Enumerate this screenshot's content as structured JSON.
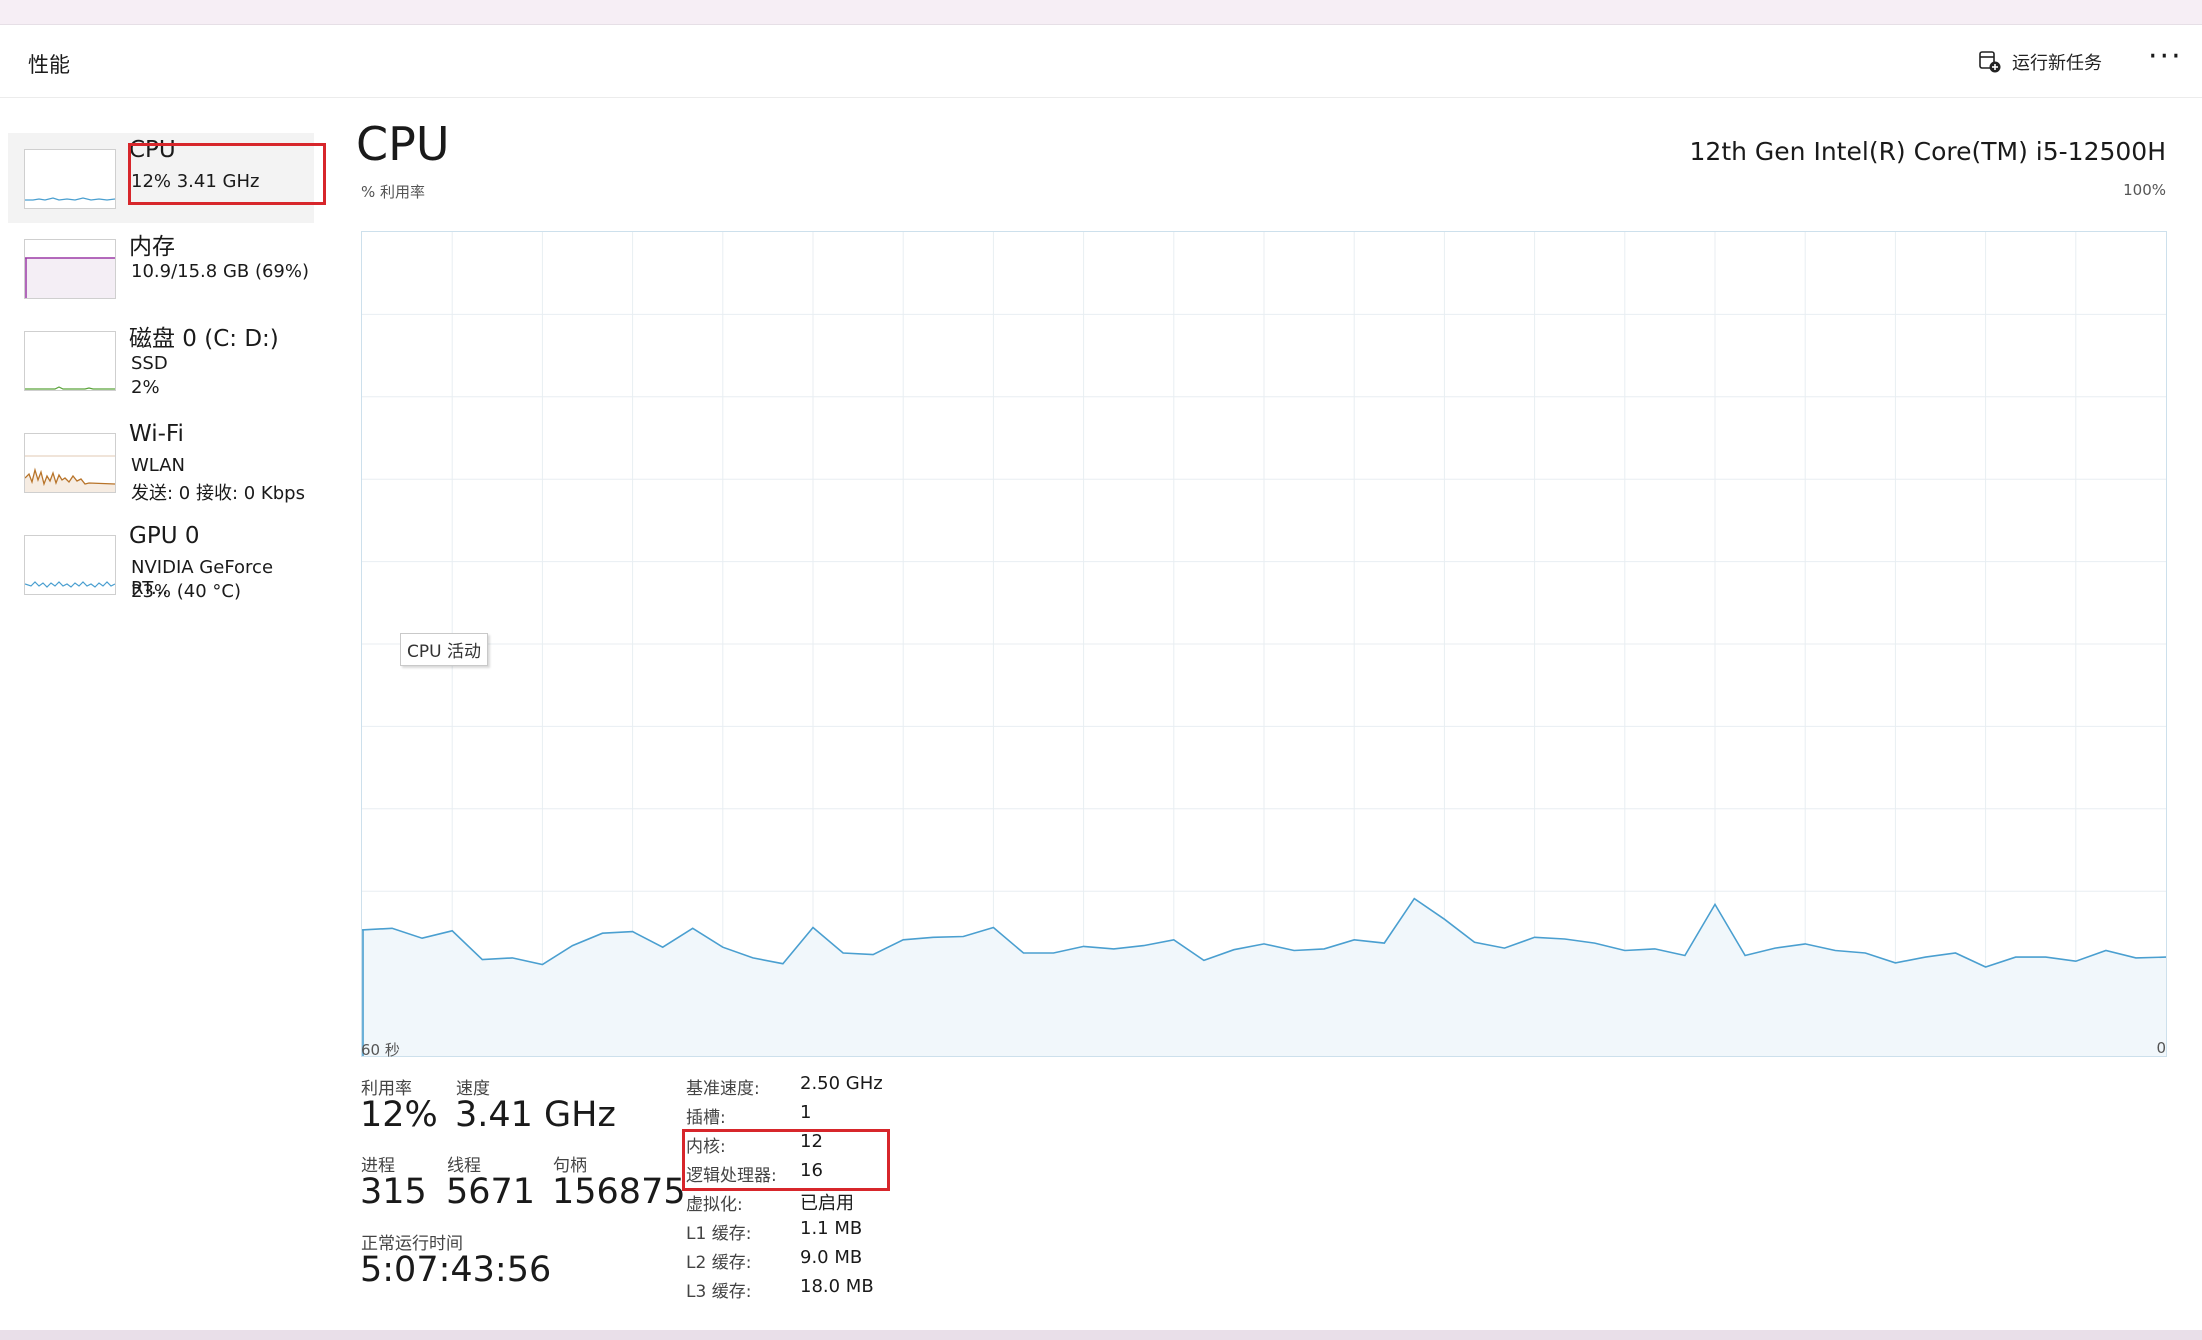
{
  "header": {
    "title": "性能",
    "run_task_label": "运行新任务",
    "more_label": "···"
  },
  "sidebar": {
    "items": [
      {
        "title": "CPU",
        "line1": "12%  3.41 GHz",
        "line2": ""
      },
      {
        "title": "内存",
        "line1": "10.9/15.8 GB (69%)",
        "line2": ""
      },
      {
        "title": "磁盘 0 (C: D:)",
        "line1": "SSD",
        "line2": "2%"
      },
      {
        "title": "Wi-Fi",
        "line1": "WLAN",
        "line2": "发送: 0 接收: 0 Kbps"
      },
      {
        "title": "GPU 0",
        "line1": "NVIDIA GeForce RT...",
        "line2": "23%  (40 °C)"
      }
    ]
  },
  "main": {
    "title": "CPU",
    "cpu_model": "12th Gen Intel(R) Core(TM) i5-12500H",
    "y_axis_label": "% 利用率",
    "y_max_label": "100%",
    "x_left_label": "60 秒",
    "x_right_label": "0",
    "tooltip": "CPU 活动"
  },
  "chart_data": {
    "type": "area",
    "ylim": [
      0,
      100
    ],
    "xlim": [
      60,
      0
    ],
    "ylabel": "% 利用率",
    "grid": true,
    "color": "#4a9fd0",
    "x": [
      60,
      59,
      58,
      57,
      56,
      55,
      54,
      53,
      52,
      51,
      50,
      49,
      48,
      47,
      46,
      45,
      44,
      43,
      42,
      41,
      40,
      39,
      38,
      37,
      36,
      35,
      34,
      33,
      32,
      31,
      30,
      29,
      28,
      27,
      26,
      25,
      24,
      23,
      22,
      21,
      20,
      19,
      18,
      17,
      16,
      15,
      14,
      13,
      12,
      11,
      10,
      9,
      8,
      7,
      6,
      5,
      4,
      3,
      2,
      1,
      0
    ],
    "values": [
      15.3,
      15.5,
      14.3,
      15.2,
      11.7,
      11.9,
      11.1,
      13.4,
      14.9,
      15.1,
      13.2,
      15.5,
      13.2,
      11.9,
      11.2,
      15.6,
      12.5,
      12.3,
      14.1,
      14.4,
      14.5,
      15.6,
      12.5,
      12.5,
      13.3,
      13.0,
      13.4,
      14.1,
      11.6,
      12.9,
      13.6,
      12.8,
      13.0,
      14.1,
      13.7,
      19.1,
      16.6,
      13.8,
      13.1,
      14.4,
      14.2,
      13.7,
      12.8,
      13.0,
      12.2,
      18.4,
      12.2,
      13.1,
      13.6,
      12.8,
      12.5,
      11.3,
      12.0,
      12.5,
      10.8,
      12.0,
      12.0,
      11.5,
      12.8,
      11.9,
      12.0
    ]
  },
  "stats": {
    "utilization_label": "利用率",
    "utilization_value": "12%",
    "speed_label": "速度",
    "speed_value": "3.41 GHz",
    "processes_label": "进程",
    "processes_value": "315",
    "threads_label": "线程",
    "threads_value": "5671",
    "handles_label": "句柄",
    "handles_value": "156875",
    "uptime_label": "正常运行时间",
    "uptime_value": "5:07:43:56"
  },
  "specs": [
    {
      "label": "基准速度:",
      "value": "2.50 GHz"
    },
    {
      "label": "插槽:",
      "value": "1"
    },
    {
      "label": "内核:",
      "value": "12"
    },
    {
      "label": "逻辑处理器:",
      "value": "16"
    },
    {
      "label": "虚拟化:",
      "value": "已启用"
    },
    {
      "label": "L1 缓存:",
      "value": "1.1 MB"
    },
    {
      "label": "L2 缓存:",
      "value": "9.0 MB"
    },
    {
      "label": "L3 缓存:",
      "value": "18.0 MB"
    }
  ],
  "colors": {
    "cpu": "#4a9fd0",
    "memory": "#9b3aa6",
    "disk": "#5aa33a",
    "wifi": "#b8742a",
    "gpu": "#4a9fd0",
    "highlight": "#d7262b"
  },
  "icons": {
    "run_task": "new-task-icon",
    "more": "more-dots-icon"
  }
}
